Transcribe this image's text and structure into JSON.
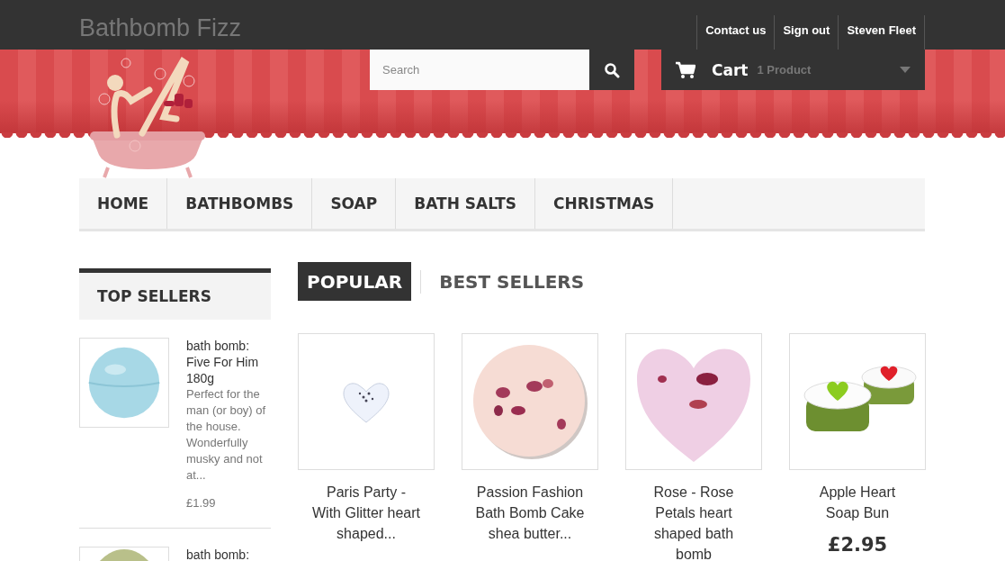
{
  "header": {
    "shop_name": "Bathbomb Fizz",
    "links": [
      "Contact us",
      "Sign out",
      "Steven Fleet"
    ],
    "search": {
      "placeholder": "Search"
    },
    "cart": {
      "label": "Cart",
      "count": "1 Product"
    }
  },
  "nav": [
    {
      "label": "HOME",
      "selected": false
    },
    {
      "label": "BATHBOMBS",
      "selected": false
    },
    {
      "label": "SOAP",
      "selected": false
    },
    {
      "label": "BATH SALTS",
      "selected": false
    },
    {
      "label": "CHRISTMAS",
      "selected": false
    }
  ],
  "sidebar": {
    "title": "TOP SELLERS",
    "items": [
      {
        "kind": "ball-blue",
        "title": "bath bomb: Five For Him 180g",
        "description": "Perfect for the man (or boy) of the house.  Wonderfully musky and not at...",
        "price": "£1.99"
      },
      {
        "kind": "ball-green",
        "title": "bath bomb:"
      }
    ]
  },
  "tabs": [
    {
      "label": "POPULAR",
      "selected": true
    },
    {
      "label": "BEST SELLERS",
      "selected": false
    }
  ],
  "products": [
    {
      "kind": "heart-white",
      "title": "Paris Party - With Glitter heart shaped..."
    },
    {
      "kind": "round-pink",
      "title": "Passion Fashion Bath Bomb Cake shea butter..."
    },
    {
      "kind": "heart-pink",
      "title": "Rose - Rose Petals heart shaped bath bomb"
    },
    {
      "kind": "soap-buns",
      "title": "Apple Heart Soap Bun",
      "price": "£2.95"
    }
  ]
}
